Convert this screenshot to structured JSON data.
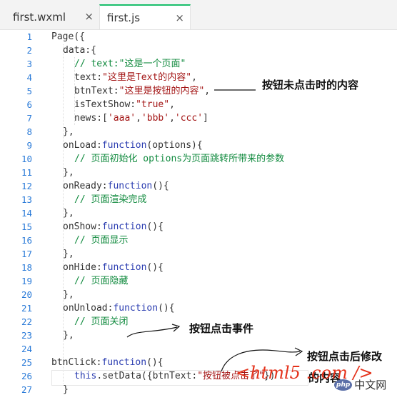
{
  "tabs": [
    {
      "label": "first.wxml",
      "close": "×",
      "active": false
    },
    {
      "label": "first.js",
      "close": "×",
      "active": true
    }
  ],
  "line_numbers": [
    "1",
    "2",
    "3",
    "4",
    "5",
    "6",
    "7",
    "8",
    "9",
    "10",
    "11",
    "12",
    "13",
    "14",
    "15",
    "16",
    "17",
    "18",
    "19",
    "20",
    "21",
    "22",
    "23",
    "24",
    "25",
    "26",
    "27"
  ],
  "code": {
    "l1": "Page({",
    "l2": "data:{",
    "l3": "// text:\"这是一个页面\"",
    "l4a": "text:",
    "l4b": "\"这里是Text的内容\"",
    "l4c": ",",
    "l5a": "btnText:",
    "l5b": "\"这里是按钮的内容\"",
    "l5c": ",",
    "l6a": "isTextShow:",
    "l6b": "\"true\"",
    "l6c": ",",
    "l7a": "news:[",
    "l7b": "'aaa'",
    "l7c": ",",
    "l7d": "'bbb'",
    "l7e": ",",
    "l7f": "'ccc'",
    "l7g": "]",
    "l8": "},",
    "l9a": "onLoad:",
    "l9b": "function",
    "l9c": "(options){",
    "l10": "// 页面初始化 options为页面跳转所带来的参数",
    "l11": "},",
    "l12a": "onReady:",
    "l12b": "function",
    "l12c": "(){",
    "l13": "// 页面渲染完成",
    "l14": "},",
    "l15a": "onShow:",
    "l15b": "function",
    "l15c": "(){",
    "l16": "// 页面显示",
    "l17": "},",
    "l18a": "onHide:",
    "l18b": "function",
    "l18c": "(){",
    "l19": "// 页面隐藏",
    "l20": "},",
    "l21a": "onUnload:",
    "l21b": "function",
    "l21c": "(){",
    "l22": "// 页面关闭",
    "l23": "},",
    "l24": "",
    "l25a": "btnClick:",
    "l25b": "function",
    "l25c": "(){",
    "l26a": "this",
    "l26b": ".setData({btnText:",
    "l26c": "\"按钮被点击了\"",
    "l26d": "})",
    "l27": "}"
  },
  "annotations": {
    "not_clicked": "按钮未点击时的内容",
    "click_event": "按钮点击事件",
    "after_click": "按钮点击后修改",
    "after_click_2": "的内容"
  },
  "watermark": {
    "site": "<html5 .com />",
    "logo_badge": "php",
    "logo_text": "中文网"
  },
  "colors": {
    "line_number": "#2b7bd8",
    "keyword": "#2a3cb0",
    "string": "#a31515",
    "comment": "#108a3e",
    "tab_active_border": "#19be6b",
    "watermark": "#e4321b"
  }
}
